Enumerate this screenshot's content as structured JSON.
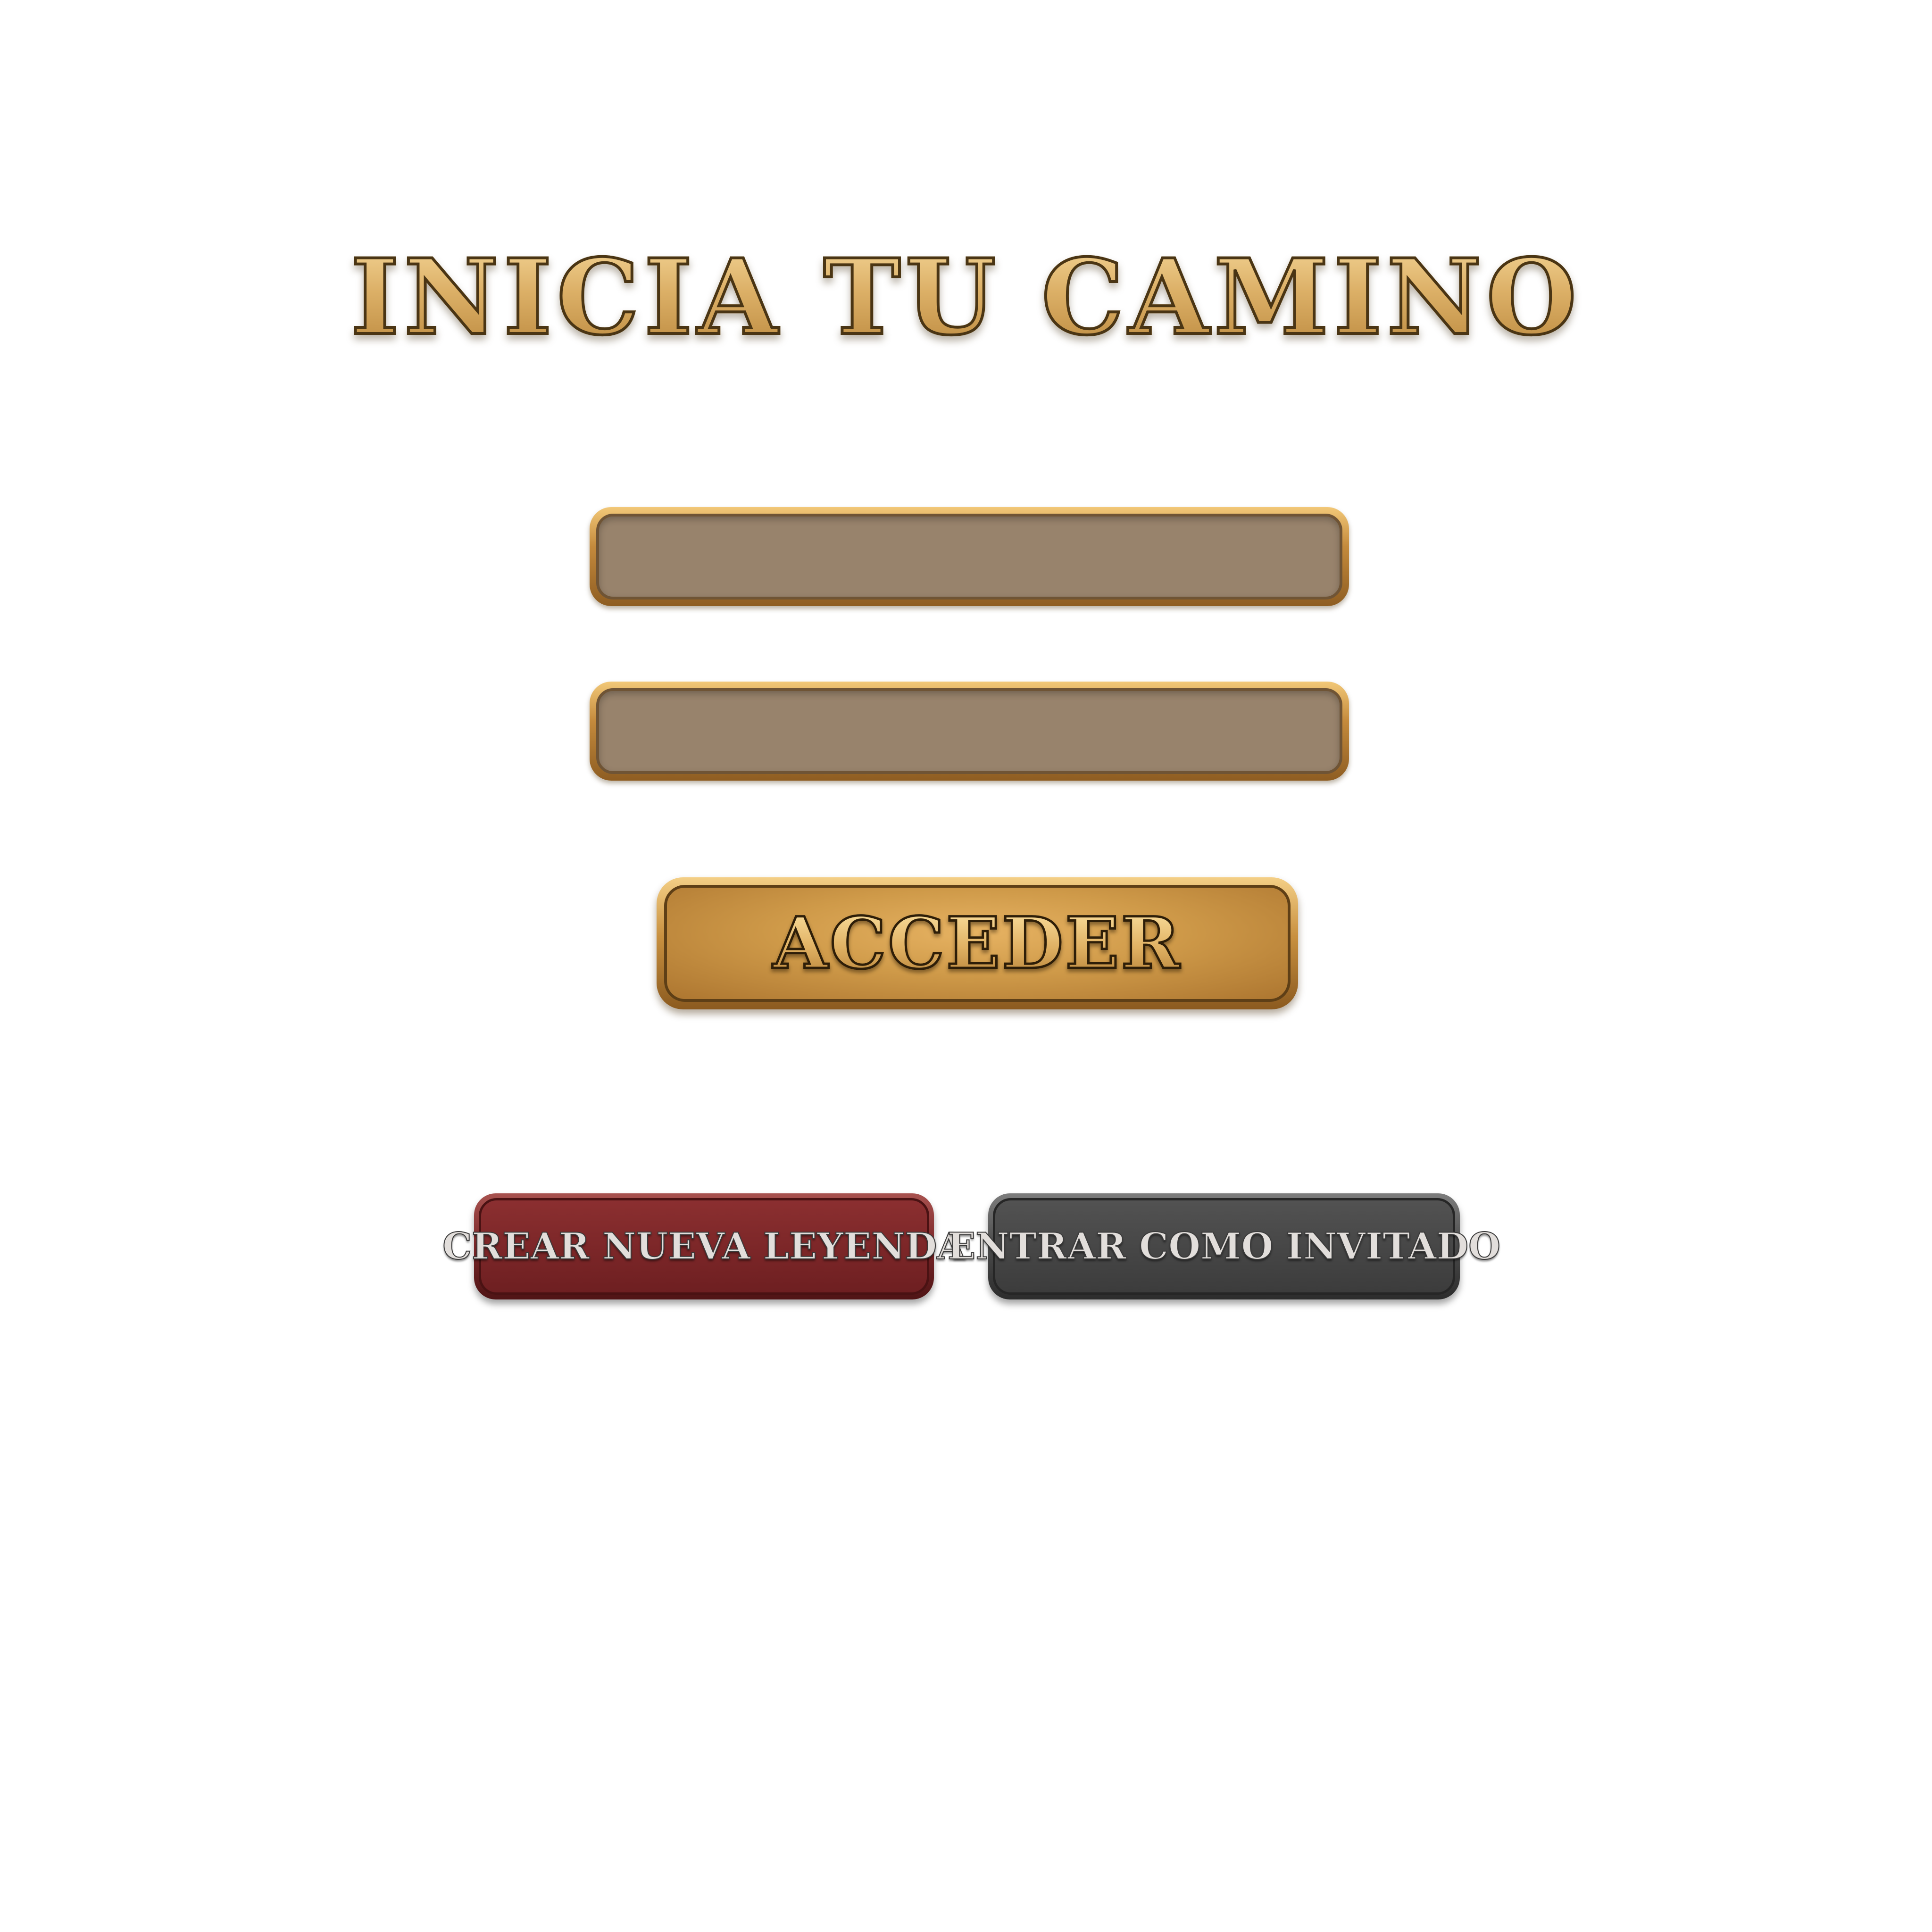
{
  "login": {
    "title": "INICIA TU CAMINO",
    "username_field": {
      "value": "",
      "placeholder": ""
    },
    "password_field": {
      "value": "",
      "placeholder": ""
    },
    "submit_label": "ACCEDER",
    "create_account_label": "CREAR NUEVA LEYENDA",
    "guest_label": "ENTRAR COMO INVITADO"
  },
  "colors": {
    "gold": "#d7a95c",
    "field_fill": "#98836c",
    "create_red": "#7a2628",
    "guest_gray": "#4b4b4b"
  }
}
